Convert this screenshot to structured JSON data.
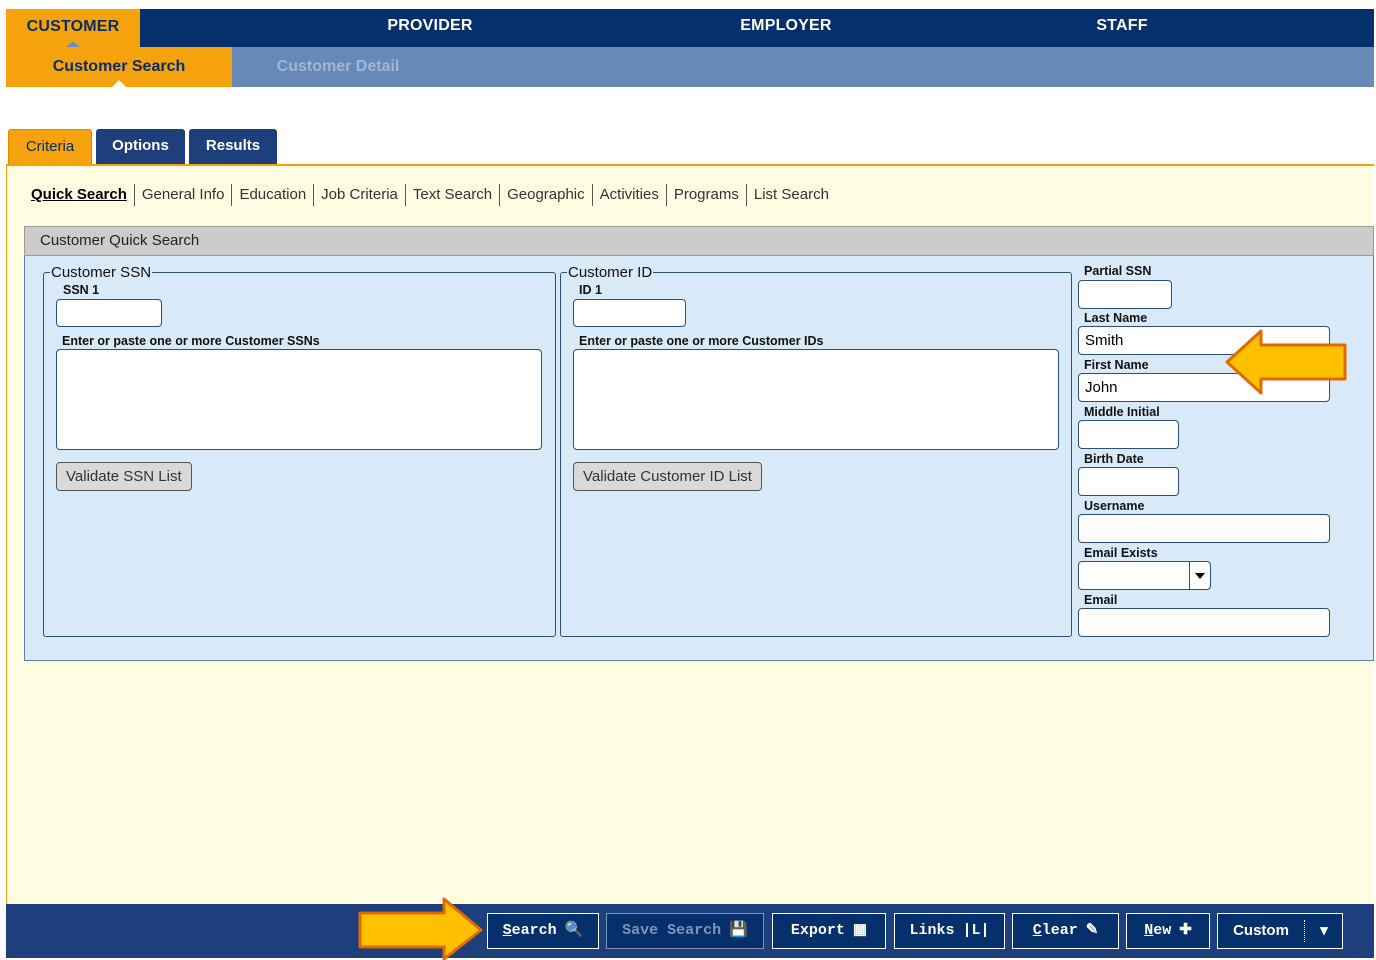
{
  "top_nav": [
    {
      "label": "CUSTOMER",
      "active": true
    },
    {
      "label": "PROVIDER",
      "active": false
    },
    {
      "label": "EMPLOYER",
      "active": false
    },
    {
      "label": "STAFF",
      "active": false
    }
  ],
  "sub_nav": [
    {
      "label": "Customer Search",
      "active": true
    },
    {
      "label": "Customer Detail",
      "active": false
    }
  ],
  "tabs": [
    {
      "label": "Criteria",
      "active": true
    },
    {
      "label": "Options",
      "active": false
    },
    {
      "label": "Results",
      "active": false
    }
  ],
  "search_links": [
    "Quick Search",
    "General Info",
    "Education",
    "Job Criteria",
    "Text Search",
    "Geographic",
    "Activities",
    "Programs",
    "List Search"
  ],
  "quick_search": {
    "title": "Customer Quick Search",
    "ssn_group": {
      "legend": "Customer SSN",
      "field_label": "SSN 1",
      "field_value": "",
      "list_label": "Enter or paste one or more Customer SSNs",
      "validate_button": "Validate SSN List"
    },
    "id_group": {
      "legend": "Customer ID",
      "field_label": "ID 1",
      "field_value": "",
      "list_label": "Enter or paste one or more Customer IDs",
      "validate_button": "Validate Customer ID List"
    },
    "fields": {
      "partial_ssn": {
        "label": "Partial SSN",
        "value": ""
      },
      "last_name": {
        "label": "Last Name",
        "value": "Smith"
      },
      "first_name": {
        "label": "First Name",
        "value": "John"
      },
      "middle_initial": {
        "label": "Middle Initial",
        "value": ""
      },
      "birth_date": {
        "label": "Birth Date",
        "value": ""
      },
      "username": {
        "label": "Username",
        "value": ""
      },
      "email_exists": {
        "label": "Email Exists",
        "value": ""
      },
      "email": {
        "label": "Email",
        "value": ""
      }
    }
  },
  "actions": {
    "search": {
      "pre": "",
      "u": "S",
      "post": "earch",
      "icon": "🔍"
    },
    "save_search": {
      "pre": "Save Search",
      "u": "",
      "post": "",
      "icon": "💾"
    },
    "export": {
      "pre": "Export",
      "u": "",
      "post": "",
      "icon": "▦"
    },
    "links": {
      "pre": "Links",
      "u": "",
      "post": "",
      "icon": "|L|"
    },
    "clear": {
      "pre": "",
      "u": "C",
      "post": "lear",
      "icon": "✎"
    },
    "new": {
      "pre": "",
      "u": "N",
      "post": "ew",
      "icon": "✚"
    },
    "custom": {
      "label": "Custom",
      "icon": "▾"
    }
  },
  "colors": {
    "navy": "#05306b",
    "gold": "#f5a20c",
    "subnav_blue": "#6789b8",
    "panel_cream": "#fffde1",
    "form_blue": "#d8eaf8",
    "callout_arrow": "#ffc000"
  }
}
